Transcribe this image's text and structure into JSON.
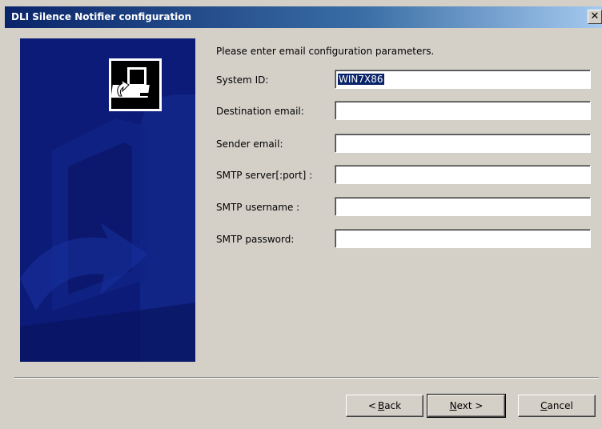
{
  "window": {
    "title": "DLI Silence Notifier configuration",
    "close_glyph": "✕"
  },
  "form": {
    "intro": "Please enter email configuration parameters.",
    "fields": [
      {
        "label": "System ID:",
        "value": "WIN7X86"
      },
      {
        "label": "Destination email:",
        "value": ""
      },
      {
        "label": "Sender email:",
        "value": ""
      },
      {
        "label": "SMTP server[:port] :",
        "value": ""
      },
      {
        "label": "SMTP username :",
        "value": ""
      },
      {
        "label": "SMTP password:",
        "value": ""
      }
    ]
  },
  "buttons": {
    "back": {
      "prefix": "< ",
      "mnemonic": "B",
      "rest": "ack"
    },
    "next": {
      "mnemonic": "N",
      "rest": "ext >"
    },
    "cancel": {
      "mnemonic": "C",
      "rest": "ancel"
    }
  },
  "colors": {
    "panel_blue": "#0c1b78",
    "title_gradient_start": "#0a246a"
  },
  "icons": {
    "logo": "computer-arrow-logo-icon"
  }
}
